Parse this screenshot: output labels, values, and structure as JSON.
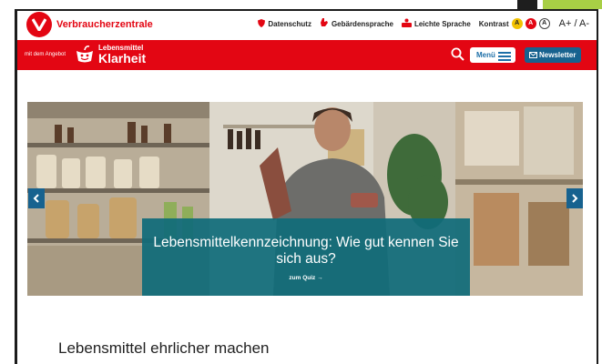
{
  "header": {
    "brand": "Verbraucherzentrale",
    "links": [
      {
        "label": "Datenschutz",
        "icon": "shield-icon"
      },
      {
        "label": "Gebärdensprache",
        "icon": "sign-language-icon"
      },
      {
        "label": "Leichte Sprache",
        "icon": "easy-language-icon"
      }
    ],
    "contrast_label": "Kontrast",
    "contrast_options": [
      "A",
      "A",
      "A"
    ],
    "font_size_label": "A+ / A-"
  },
  "navbar": {
    "offer_text": "mit dem Angebot",
    "product_small": "Lebensmittel",
    "product_big": "Klarheit",
    "menu_label": "Menü",
    "newsletter_label": "Newsletter"
  },
  "hero": {
    "title": "Lebensmittelkennzeichnung: Wie gut kennen Sie sich aus?",
    "cta": "zum Quiz →"
  },
  "section": {
    "title": "Lebensmittel ehrlicher machen"
  },
  "colors": {
    "brand_red": "#e30613",
    "link_blue": "#17628f",
    "overlay_teal": "#106c7a"
  }
}
